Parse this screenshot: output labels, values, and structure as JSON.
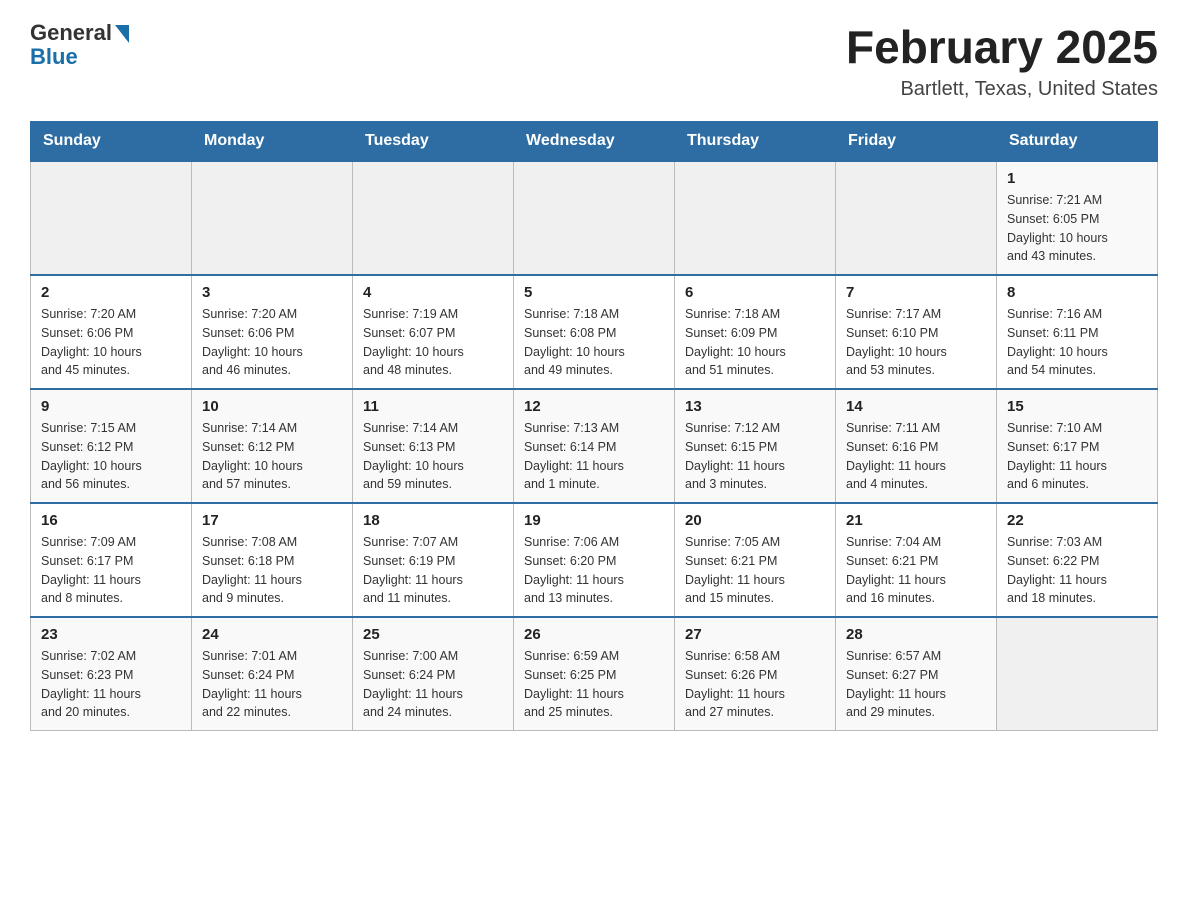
{
  "logo": {
    "general": "General",
    "blue": "Blue"
  },
  "header": {
    "title": "February 2025",
    "location": "Bartlett, Texas, United States"
  },
  "days_of_week": [
    "Sunday",
    "Monday",
    "Tuesday",
    "Wednesday",
    "Thursday",
    "Friday",
    "Saturday"
  ],
  "weeks": [
    [
      {
        "day": "",
        "info": ""
      },
      {
        "day": "",
        "info": ""
      },
      {
        "day": "",
        "info": ""
      },
      {
        "day": "",
        "info": ""
      },
      {
        "day": "",
        "info": ""
      },
      {
        "day": "",
        "info": ""
      },
      {
        "day": "1",
        "info": "Sunrise: 7:21 AM\nSunset: 6:05 PM\nDaylight: 10 hours\nand 43 minutes."
      }
    ],
    [
      {
        "day": "2",
        "info": "Sunrise: 7:20 AM\nSunset: 6:06 PM\nDaylight: 10 hours\nand 45 minutes."
      },
      {
        "day": "3",
        "info": "Sunrise: 7:20 AM\nSunset: 6:06 PM\nDaylight: 10 hours\nand 46 minutes."
      },
      {
        "day": "4",
        "info": "Sunrise: 7:19 AM\nSunset: 6:07 PM\nDaylight: 10 hours\nand 48 minutes."
      },
      {
        "day": "5",
        "info": "Sunrise: 7:18 AM\nSunset: 6:08 PM\nDaylight: 10 hours\nand 49 minutes."
      },
      {
        "day": "6",
        "info": "Sunrise: 7:18 AM\nSunset: 6:09 PM\nDaylight: 10 hours\nand 51 minutes."
      },
      {
        "day": "7",
        "info": "Sunrise: 7:17 AM\nSunset: 6:10 PM\nDaylight: 10 hours\nand 53 minutes."
      },
      {
        "day": "8",
        "info": "Sunrise: 7:16 AM\nSunset: 6:11 PM\nDaylight: 10 hours\nand 54 minutes."
      }
    ],
    [
      {
        "day": "9",
        "info": "Sunrise: 7:15 AM\nSunset: 6:12 PM\nDaylight: 10 hours\nand 56 minutes."
      },
      {
        "day": "10",
        "info": "Sunrise: 7:14 AM\nSunset: 6:12 PM\nDaylight: 10 hours\nand 57 minutes."
      },
      {
        "day": "11",
        "info": "Sunrise: 7:14 AM\nSunset: 6:13 PM\nDaylight: 10 hours\nand 59 minutes."
      },
      {
        "day": "12",
        "info": "Sunrise: 7:13 AM\nSunset: 6:14 PM\nDaylight: 11 hours\nand 1 minute."
      },
      {
        "day": "13",
        "info": "Sunrise: 7:12 AM\nSunset: 6:15 PM\nDaylight: 11 hours\nand 3 minutes."
      },
      {
        "day": "14",
        "info": "Sunrise: 7:11 AM\nSunset: 6:16 PM\nDaylight: 11 hours\nand 4 minutes."
      },
      {
        "day": "15",
        "info": "Sunrise: 7:10 AM\nSunset: 6:17 PM\nDaylight: 11 hours\nand 6 minutes."
      }
    ],
    [
      {
        "day": "16",
        "info": "Sunrise: 7:09 AM\nSunset: 6:17 PM\nDaylight: 11 hours\nand 8 minutes."
      },
      {
        "day": "17",
        "info": "Sunrise: 7:08 AM\nSunset: 6:18 PM\nDaylight: 11 hours\nand 9 minutes."
      },
      {
        "day": "18",
        "info": "Sunrise: 7:07 AM\nSunset: 6:19 PM\nDaylight: 11 hours\nand 11 minutes."
      },
      {
        "day": "19",
        "info": "Sunrise: 7:06 AM\nSunset: 6:20 PM\nDaylight: 11 hours\nand 13 minutes."
      },
      {
        "day": "20",
        "info": "Sunrise: 7:05 AM\nSunset: 6:21 PM\nDaylight: 11 hours\nand 15 minutes."
      },
      {
        "day": "21",
        "info": "Sunrise: 7:04 AM\nSunset: 6:21 PM\nDaylight: 11 hours\nand 16 minutes."
      },
      {
        "day": "22",
        "info": "Sunrise: 7:03 AM\nSunset: 6:22 PM\nDaylight: 11 hours\nand 18 minutes."
      }
    ],
    [
      {
        "day": "23",
        "info": "Sunrise: 7:02 AM\nSunset: 6:23 PM\nDaylight: 11 hours\nand 20 minutes."
      },
      {
        "day": "24",
        "info": "Sunrise: 7:01 AM\nSunset: 6:24 PM\nDaylight: 11 hours\nand 22 minutes."
      },
      {
        "day": "25",
        "info": "Sunrise: 7:00 AM\nSunset: 6:24 PM\nDaylight: 11 hours\nand 24 minutes."
      },
      {
        "day": "26",
        "info": "Sunrise: 6:59 AM\nSunset: 6:25 PM\nDaylight: 11 hours\nand 25 minutes."
      },
      {
        "day": "27",
        "info": "Sunrise: 6:58 AM\nSunset: 6:26 PM\nDaylight: 11 hours\nand 27 minutes."
      },
      {
        "day": "28",
        "info": "Sunrise: 6:57 AM\nSunset: 6:27 PM\nDaylight: 11 hours\nand 29 minutes."
      },
      {
        "day": "",
        "info": ""
      }
    ]
  ]
}
